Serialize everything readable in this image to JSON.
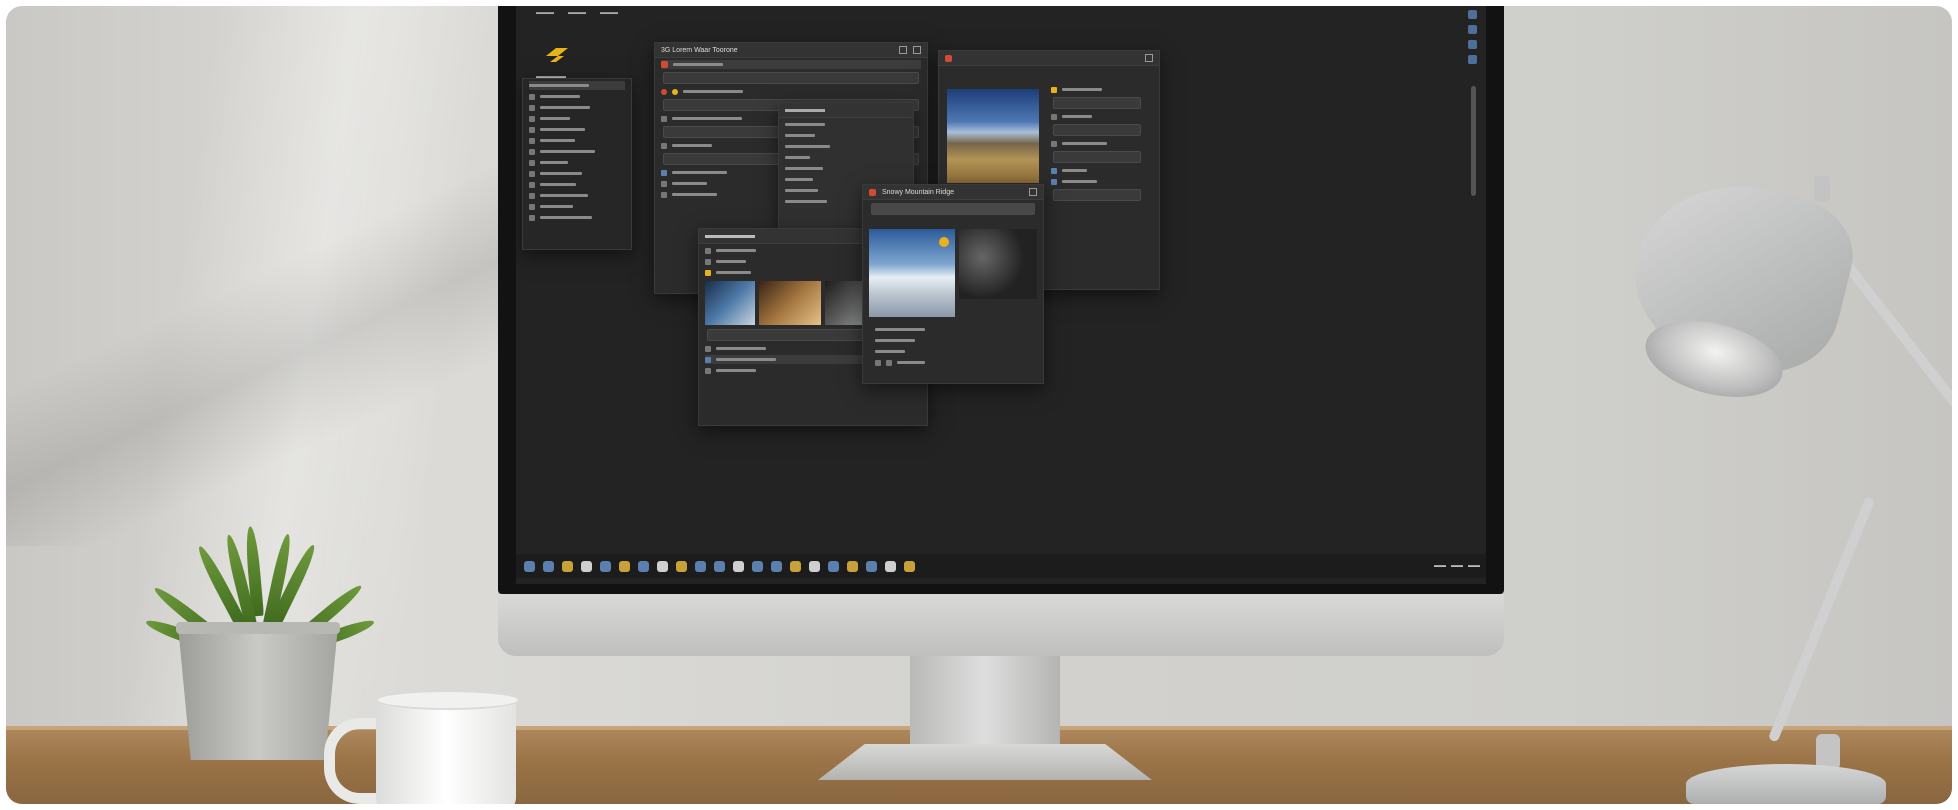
{
  "scene": {
    "objects": [
      "desktop-monitor",
      "potted-plant",
      "coffee-mug",
      "desk-lamp",
      "wooden-desk"
    ],
    "colors": {
      "wall": "#d2d1cd",
      "desk": "#9a7447",
      "screen_bg": "#232323",
      "accent_red": "#d24b33",
      "accent_yellow": "#e8b21a"
    }
  },
  "screen": {
    "window_title": "3G Lorem Waar Toorone",
    "viewer_title": "Snowy Mountain Ridge",
    "icons": {
      "logo": "logo-icon",
      "taskbar": [
        "windows-icon",
        "folder-icon",
        "browser-icon",
        "mail-icon",
        "store-icon",
        "settings-icon"
      ]
    }
  }
}
